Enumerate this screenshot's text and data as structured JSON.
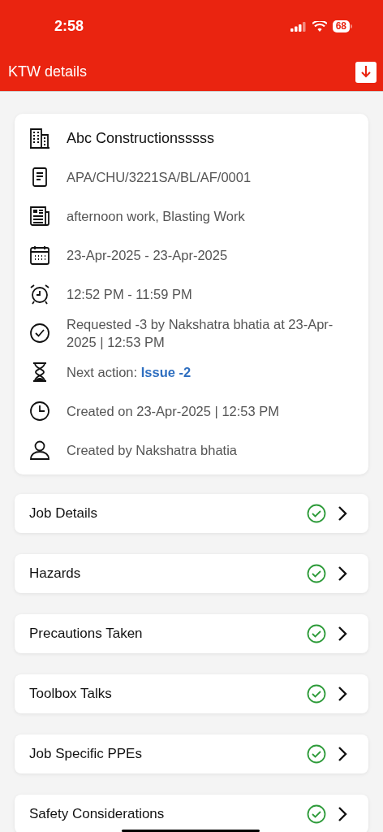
{
  "status_bar": {
    "time": "2:58",
    "battery": "68"
  },
  "header": {
    "title": "KTW details"
  },
  "summary": [
    {
      "kind": "building",
      "text": "Abc Constructionsssss"
    },
    {
      "kind": "document",
      "text": "APA/CHU/3221SA/BL/AF/0001"
    },
    {
      "kind": "newspaper",
      "text": "afternoon work, Blasting Work"
    },
    {
      "kind": "calendar",
      "text": "23-Apr-2025 - 23-Apr-2025"
    },
    {
      "kind": "alarm",
      "text": "12:52 PM - 11:59 PM"
    },
    {
      "kind": "check",
      "text": "Requested -3 by Nakshatra bhatia at 23-Apr-2025 | 12:53 PM"
    },
    {
      "kind": "hourglass",
      "text": "Next action: ",
      "link": "Issue -2"
    },
    {
      "kind": "clock",
      "text": "Created on 23-Apr-2025 | 12:53 PM"
    },
    {
      "kind": "person",
      "text": "Created by Nakshatra bhatia"
    }
  ],
  "sections": [
    {
      "label": "Job Details",
      "completed": true
    },
    {
      "label": "Hazards",
      "completed": true
    },
    {
      "label": "Precautions Taken",
      "completed": true
    },
    {
      "label": "Toolbox Talks",
      "completed": true
    },
    {
      "label": "Job Specific PPEs",
      "completed": true
    },
    {
      "label": "Safety Considerations",
      "completed": true
    }
  ]
}
